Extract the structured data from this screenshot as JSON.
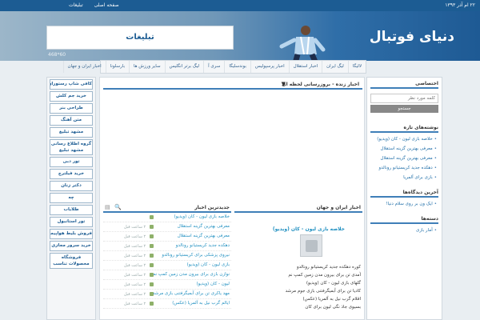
{
  "topbar": {
    "date": "۲۲ ام آذر ۱۳۹۳",
    "links": [
      "صفحه اصلی",
      "تبلیغات"
    ]
  },
  "header": {
    "site_title": "دنیای فوتبال",
    "ad_label": "تبلیغات",
    "ad_size": "468*60"
  },
  "nav": {
    "items": [
      "لالیگا",
      "لیگ ایران",
      "اخبار استقلال",
      "اخبار پرسپولیس",
      "بوندسلیگا",
      "سری آ",
      "لیگ برتر انگلیس",
      "سایر ورزش ها",
      "بارسلونا",
      "اخبار ایران و جهان"
    ]
  },
  "leftbar": {
    "items": [
      {
        "label": "کافی شاپ رستوران",
        "tall": false
      },
      {
        "label": "خرید جم کلش",
        "tall": false
      },
      {
        "label": "طراحی بنر",
        "tall": false
      },
      {
        "label": "متن آهنگ",
        "tall": false
      },
      {
        "label": "مشهد تبلیغ",
        "tall": false
      },
      {
        "label": "گروه اطلاع رسانی مشهد تبلیغ",
        "tall": true
      },
      {
        "label": "تور دبی",
        "tall": false
      },
      {
        "label": "خرید فیلترچ",
        "tall": false
      },
      {
        "label": "دکتر زنان",
        "tall": false
      },
      {
        "label": "چه",
        "tall": false
      },
      {
        "label": "طلایاب",
        "tall": false
      },
      {
        "label": "تور استانبول",
        "tall": false
      },
      {
        "label": "فروش بلیط هواپیما",
        "tall": false
      },
      {
        "label": "خرید سرور مجازی",
        "tall": false
      },
      {
        "label": "فروشگاه محصولات تناسب اندام",
        "tall": true
      }
    ]
  },
  "center": {
    "live_title": "اخبار زنده - بروزرسانی لحظه ای",
    "live_arrow": "▼",
    "panel_right": {
      "title": "اخبار ایران و جهان",
      "feature_title": "خلاصه بازی لیون - کان (ویدیو)",
      "rows": [
        "کوره دهکده‌ جدید کریستیانو رونالدو",
        "آمدی تن برای بیرون مدن زمین کمپ نم",
        "گلهای بازی لیون - کان (ویدیو)",
        "کادیا تن برای آبمیگرفتنی بازی جوم مرشد",
        "اقلام گرب نیل به آلمریا (عکس)",
        "بسیوی جاذ نگی لیون برای کان"
      ]
    },
    "panel_left": {
      "title": "جدیدترین اخبار",
      "items": [
        {
          "text": "خلاصه بازی لیون - کان (ویدیو)",
          "time": ""
        },
        {
          "text": "معرفی بهترین گزینه استقلال",
          "time": "۲ ساعت قبل"
        },
        {
          "text": "معرفی بهترین گزینه استقلال",
          "time": "۲ ساعت قبل"
        },
        {
          "text": "دهکده جدید کریستیانو رونالدو",
          "time": "۲ ساعت قبل"
        },
        {
          "text": "نیروی پزشکی برای کریستیانو رونالدو",
          "time": "۲ ساعت قبل"
        },
        {
          "text": "بازی لیون - کان (ویدیو)",
          "time": "۲ ساعت قبل"
        },
        {
          "text": "نوازن بازی برای بیرون مدن زمین کمپ نم",
          "time": "۲ ساعت قبل"
        },
        {
          "text": "لیون - کان (ویدیو)",
          "time": "۲ ساعت قبل"
        },
        {
          "text": "مهد یاکری تن برای آبمیگرفتنی بازی مرشد",
          "time": "۲ ساعت قبل"
        },
        {
          "text": "ایالم گرب نیل به آلمریا (عکس)",
          "time": "۲ ساعت قبل"
        }
      ]
    }
  },
  "rightbar": {
    "special_title": "اختصاصی",
    "search_placeholder": "کلمه مورد نظر",
    "search_button": "جستجو",
    "recent_title": "نوشته‌های تازه",
    "recent_posts": [
      "خلاصه بازی لیون - کان (ویدیو)",
      "معرفی بهترین گزینه استقلال",
      "معرفی بهترین گزینه استقلال",
      "دهکده جدید کریستیانو رونالدو",
      "بازی برای آلمریا"
    ],
    "recent_comments_title": "آخرین دیدگاه‌ها",
    "recent_comment": "ایک ون بر روی سلام دنیا!",
    "categories_title": "دسته‌ها",
    "category": "آمار بازی"
  }
}
